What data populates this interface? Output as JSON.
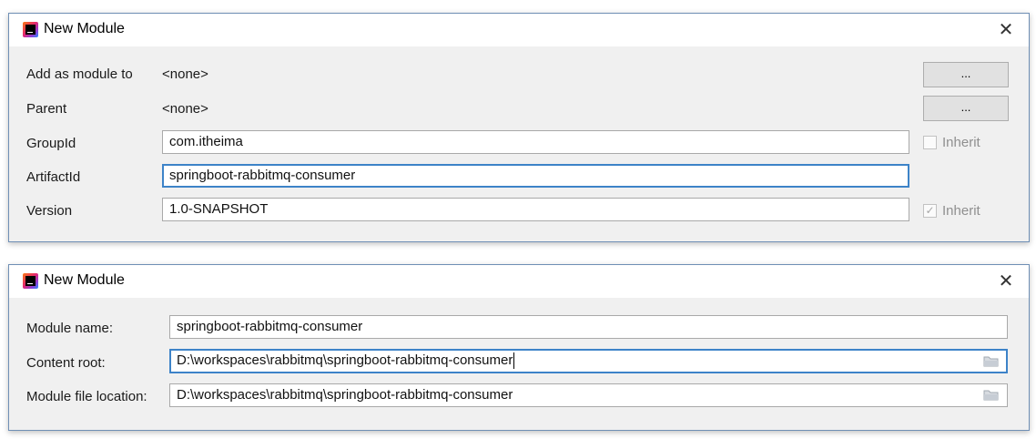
{
  "dialog1": {
    "title": "New Module",
    "close_glyph": "✕",
    "add_as_module_label": "Add as module to",
    "add_as_module_value": "<none>",
    "parent_label": "Parent",
    "parent_value": "<none>",
    "browse_label": "...",
    "groupid_label": "GroupId",
    "groupid_value": "com.itheima",
    "groupid_inherit_label": "Inherit",
    "groupid_inherit_checked": false,
    "artifactid_label": "ArtifactId",
    "artifactid_value": "springboot-rabbitmq-consumer",
    "version_label": "Version",
    "version_value": "1.0-SNAPSHOT",
    "version_inherit_label": "Inherit",
    "version_inherit_checked": true,
    "checkmark": "✓"
  },
  "dialog2": {
    "title": "New Module",
    "close_glyph": "✕",
    "module_name_label": "Module name:",
    "module_name_value": "springboot-rabbitmq-consumer",
    "content_root_label": "Content root:",
    "content_root_value": "D:\\workspaces\\rabbitmq\\springboot-rabbitmq-consumer",
    "module_file_label": "Module file location:",
    "module_file_value": "D:\\workspaces\\rabbitmq\\springboot-rabbitmq-consumer"
  },
  "icons": {
    "app": "intellij-idea-icon",
    "close": "close-icon",
    "folder": "folder-icon"
  },
  "colors": {
    "dialog_bg": "#f0f0f0",
    "focus_border": "#3d83c8",
    "window_border": "#6f8fb5"
  }
}
